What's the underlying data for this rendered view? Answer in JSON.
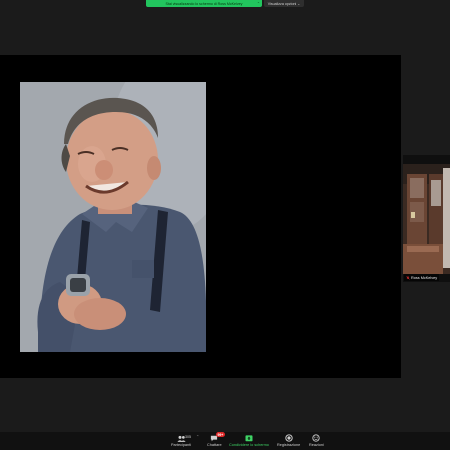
{
  "banner": {
    "share_status": "Stai visualizzando lo schermo di Ross McKelvey",
    "view_options": "Visualizza opzioni",
    "share_color": "#22c55e"
  },
  "shared_content": {
    "image": "portrait-photo"
  },
  "participant": {
    "name": "Ross McKelvey",
    "muted": true
  },
  "toolbar": {
    "participants_label": "Partecipanti",
    "participants_count": "305",
    "chat_label": "Chattare",
    "chat_badge": "99+",
    "share_label": "Condividere lo schermo",
    "record_label": "Registrazione",
    "reactions_label": "Reazioni",
    "share_color": "#3fd365"
  }
}
